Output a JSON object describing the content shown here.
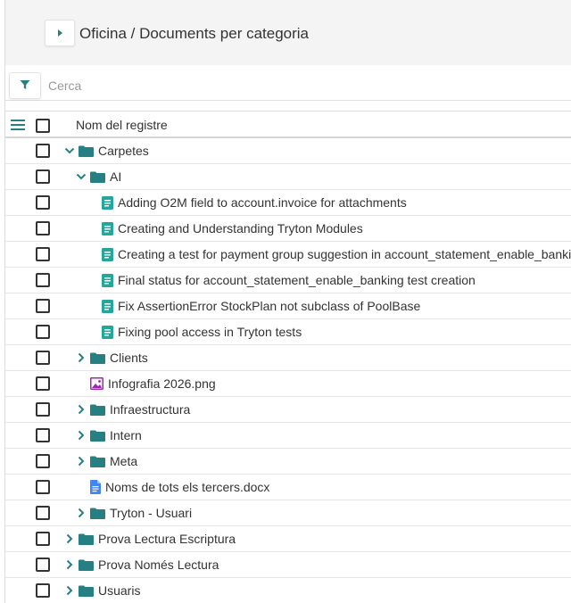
{
  "header": {
    "title": "Oficina / Documents per categoria"
  },
  "search": {
    "placeholder": "Cerca",
    "value": ""
  },
  "grid": {
    "column_header": "Nom del registre",
    "rows": [
      {
        "label": "Carpetes",
        "icon": "folder-icon",
        "toggle": "expanded",
        "level": 0
      },
      {
        "label": "AI",
        "icon": "folder-icon",
        "toggle": "expanded",
        "level": 1
      },
      {
        "label": "Adding O2M field to account.invoice for attachments",
        "icon": "document-icon",
        "toggle": "none",
        "level": 2
      },
      {
        "label": "Creating and Understanding Tryton Modules",
        "icon": "document-icon",
        "toggle": "none",
        "level": 2
      },
      {
        "label": "Creating a test for payment group suggestion in account_statement_enable_banking",
        "icon": "document-icon",
        "toggle": "none",
        "level": 2
      },
      {
        "label": "Final status for account_statement_enable_banking test creation",
        "icon": "document-icon",
        "toggle": "none",
        "level": 2
      },
      {
        "label": "Fix AssertionError StockPlan not subclass of PoolBase",
        "icon": "document-icon",
        "toggle": "none",
        "level": 2
      },
      {
        "label": "Fixing pool access in Tryton tests",
        "icon": "document-icon",
        "toggle": "none",
        "level": 2
      },
      {
        "label": "Clients",
        "icon": "folder-icon",
        "toggle": "collapsed",
        "level": 1
      },
      {
        "label": "Infografia 2026.png",
        "icon": "image-icon",
        "toggle": "none",
        "level": 1
      },
      {
        "label": "Infraestructura",
        "icon": "folder-icon",
        "toggle": "collapsed",
        "level": 1
      },
      {
        "label": "Intern",
        "icon": "folder-icon",
        "toggle": "collapsed",
        "level": 1
      },
      {
        "label": "Meta",
        "icon": "folder-icon",
        "toggle": "collapsed",
        "level": 1
      },
      {
        "label": "Noms de tots els tercers.docx",
        "icon": "docx-icon",
        "toggle": "none",
        "level": 1
      },
      {
        "label": "Tryton - Usuari",
        "icon": "folder-icon",
        "toggle": "collapsed",
        "level": 1
      },
      {
        "label": "Prova Lectura Escriptura",
        "icon": "folder-icon",
        "toggle": "collapsed",
        "level": 0
      },
      {
        "label": "Prova Només Lectura",
        "icon": "folder-icon",
        "toggle": "collapsed",
        "level": 0
      },
      {
        "label": "Usuaris",
        "icon": "folder-icon",
        "toggle": "collapsed",
        "level": 0
      }
    ]
  },
  "colors": {
    "accent": "#267f82",
    "document": "#26a69a",
    "image": "#9c27b0",
    "docx": "#4285f4",
    "header_bg": "#f4f4f4"
  }
}
